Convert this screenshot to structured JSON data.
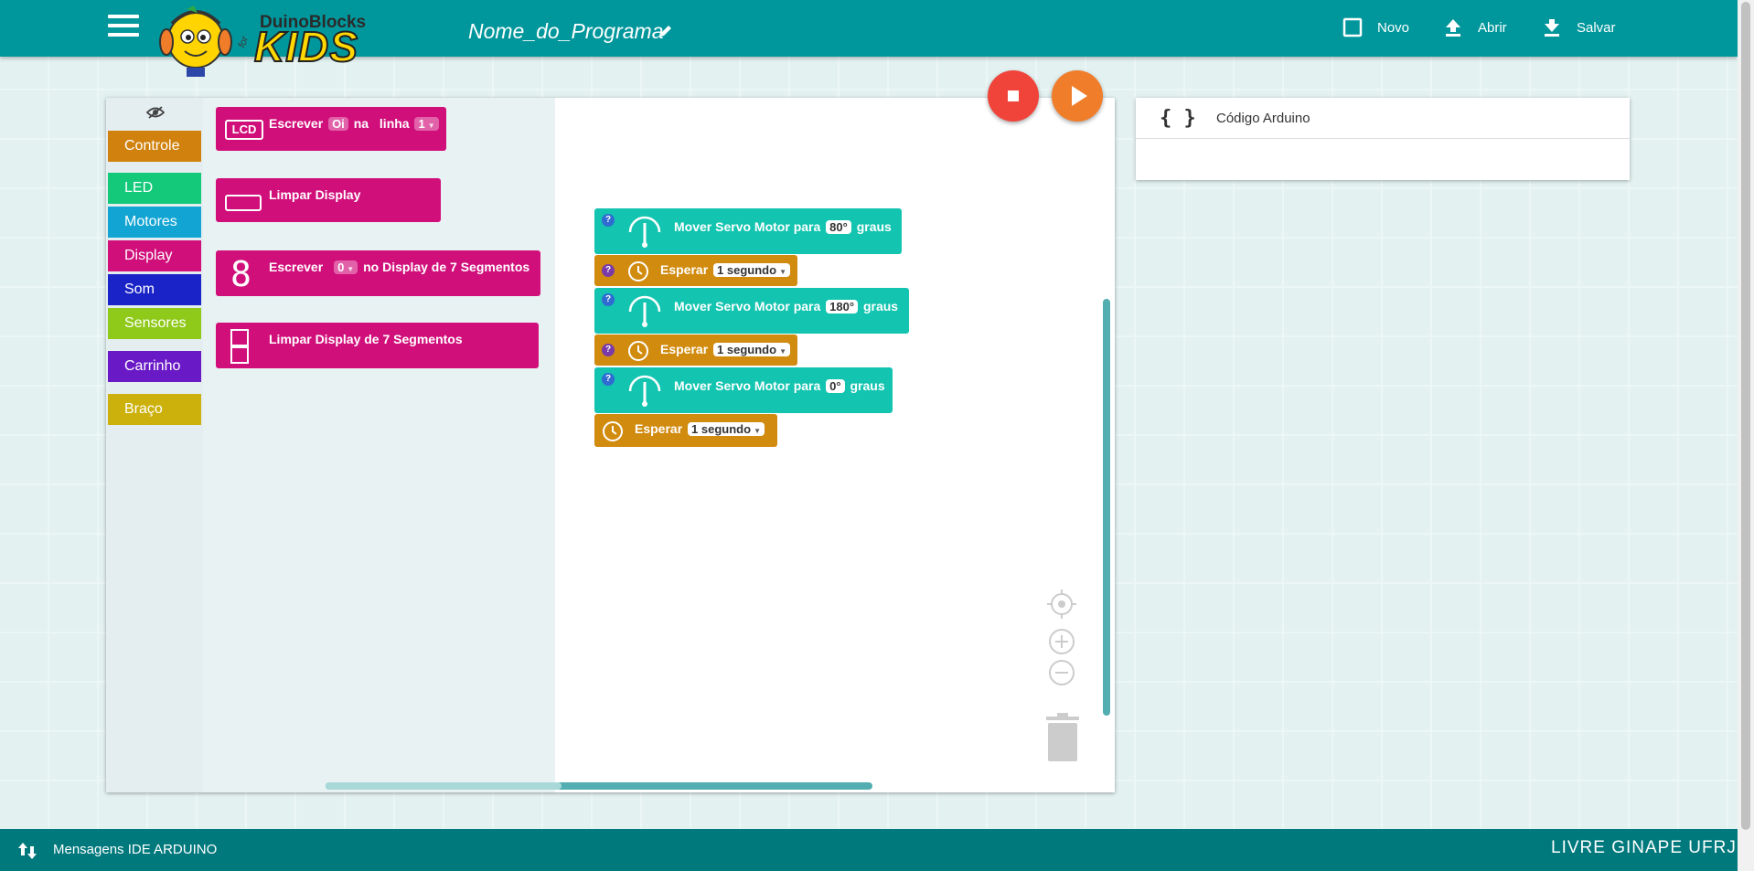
{
  "header": {
    "logo_brand": "DuinoBlocks",
    "logo_for": "for",
    "logo_kids": "KIDS",
    "program_name": "Nome_do_Programa",
    "actions": [
      {
        "label": "Novo",
        "icon": "checkbox-icon"
      },
      {
        "label": "Abrir",
        "icon": "upload-icon"
      },
      {
        "label": "Salvar",
        "icon": "download-icon"
      }
    ]
  },
  "toolbox": {
    "categories": [
      {
        "label": "Controle",
        "color": "#d1820e"
      },
      {
        "label": "LED",
        "color": "#14c97a"
      },
      {
        "label": "Motores",
        "color": "#12a4d3"
      },
      {
        "label": "Display",
        "color": "#d10f7b"
      },
      {
        "label": "Som",
        "color": "#1a23c7"
      },
      {
        "label": "Sensores",
        "color": "#8fc91a"
      },
      {
        "label": "Carrinho",
        "color": "#6a19c7"
      },
      {
        "label": "Braço",
        "color": "#ccb10c"
      }
    ]
  },
  "flyout": {
    "lcd_write": {
      "icon": "LCD",
      "text1": "Escrever",
      "value": "Oi",
      "text2": "na",
      "text3": "linha",
      "line": "1"
    },
    "lcd_clear": {
      "text": "Limpar Display"
    },
    "seg_write": {
      "icon": "8",
      "text1": "Escrever",
      "value": "0",
      "text2": "no Display de 7 Segmentos"
    },
    "seg_clear": {
      "text": "Limpar Display de 7 Segmentos"
    }
  },
  "program": {
    "servo_label": "Mover Servo Motor para",
    "servo_unit": "graus",
    "wait_label": "Esperar",
    "servo_1": "80°",
    "wait_1": "1 segundo",
    "servo_2": "180°",
    "wait_2": "1 segundo",
    "servo_3": "0°",
    "wait_3": "1 segundo",
    "help": "?"
  },
  "colors": {
    "servo": "#13c4b0",
    "wait": "#d18b0e",
    "display": "#d10f7b",
    "stop": "#f0443a",
    "play": "#f07d2a"
  },
  "code_panel": {
    "icon": "{ }",
    "title": "Código Arduino"
  },
  "footer": {
    "message": "Mensagens IDE ARDUINO",
    "credits": "LIVRE GINAPE UFRJ"
  }
}
